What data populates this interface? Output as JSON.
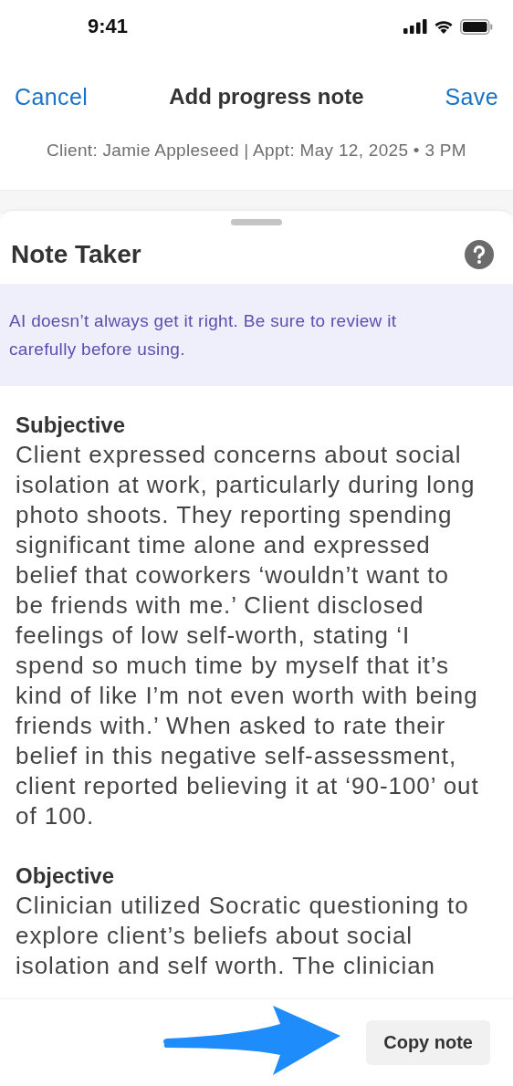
{
  "status_bar": {
    "time": "9:41"
  },
  "nav": {
    "cancel": "Cancel",
    "title": "Add progress note",
    "save": "Save",
    "subtitle": "Client: Jamie Appleseed | Appt: May 12, 2025 • 3 PM"
  },
  "sheet": {
    "title": "Note Taker",
    "banner": "AI doesn’t always get it right. Be sure to review it carefully before using.",
    "sections": [
      {
        "heading": "Subjective",
        "text": "Client expressed concerns about social isolation at work, particularly during long photo shoots. They reporting spending significant time alone and expressed belief that coworkers ‘wouldn’t want to be friends with me.’ Client disclosed feelings of low self-worth, stating ‘I spend so much time by myself that it’s kind of like I’m not even worth with being friends with.’ When asked to rate their belief in this negative self-assessment, client reported believing it at ‘90-100’ out of 100."
      },
      {
        "heading": "Objective",
        "text": "Clinician utilized Socratic questioning to explore client’s beliefs about social isolation and self worth. The clinician"
      }
    ]
  },
  "footer": {
    "button": "Copy note"
  }
}
